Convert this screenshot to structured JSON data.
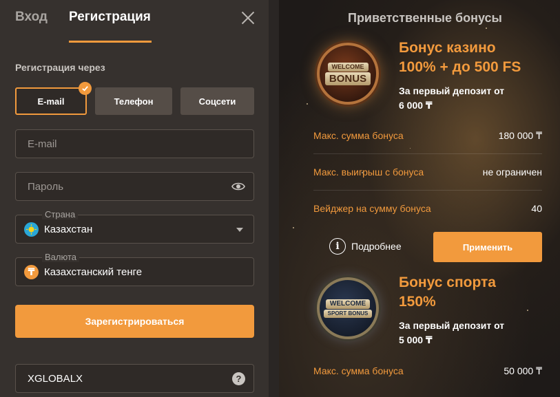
{
  "tabs": {
    "login": "Вход",
    "register": "Регистрация"
  },
  "form": {
    "via_label": "Регистрация через",
    "methods": [
      "E-mail",
      "Телефон",
      "Соцсети"
    ],
    "email_placeholder": "E-mail",
    "password_placeholder": "Пароль",
    "country_label": "Страна",
    "country_value": "Казахстан",
    "currency_label": "Валюта",
    "currency_value": "Казахстанский тенге",
    "currency_symbol": "₸",
    "register_button": "Зарегистрироваться",
    "promo_code": "XGLOBALX",
    "help_symbol": "?"
  },
  "bonuses": {
    "title": "Приветственные бонусы",
    "casino": {
      "badge_line1": "WELCOME",
      "badge_line2": "BONUS",
      "title_line1": "Бонус казино",
      "title_line2": "100% + до 500 FS",
      "subtitle_line1": "За первый депозит от",
      "subtitle_line2": "6 000 ₸",
      "rows": [
        {
          "label": "Макс. сумма бонуса",
          "value": "180 000 ₸"
        },
        {
          "label": "Макс. выигрыш с бонуса",
          "value": "не ограничен"
        },
        {
          "label": "Вейджер на сумму бонуса",
          "value": "40"
        }
      ],
      "more_label": "Подробнее",
      "info_symbol": "i",
      "apply_button": "Применить"
    },
    "sport": {
      "badge_line1": "WELCOME",
      "badge_line2": "SPORT BONUS",
      "title_line1": "Бонус спорта",
      "title_line2": "150%",
      "subtitle_line1": "За первый депозит от",
      "subtitle_line2": "5 000 ₸",
      "rows": [
        {
          "label": "Макс. сумма бонуса",
          "value": "50 000 ₸"
        }
      ]
    }
  },
  "colors": {
    "accent": "#f29a3d",
    "panel": "#36312e",
    "field_bg": "#2f2a27"
  },
  "icons": [
    "close-icon",
    "check-icon",
    "eye-icon",
    "kazakhstan-flag-icon",
    "tenge-icon",
    "chevron-down-icon",
    "help-icon",
    "info-icon"
  ]
}
